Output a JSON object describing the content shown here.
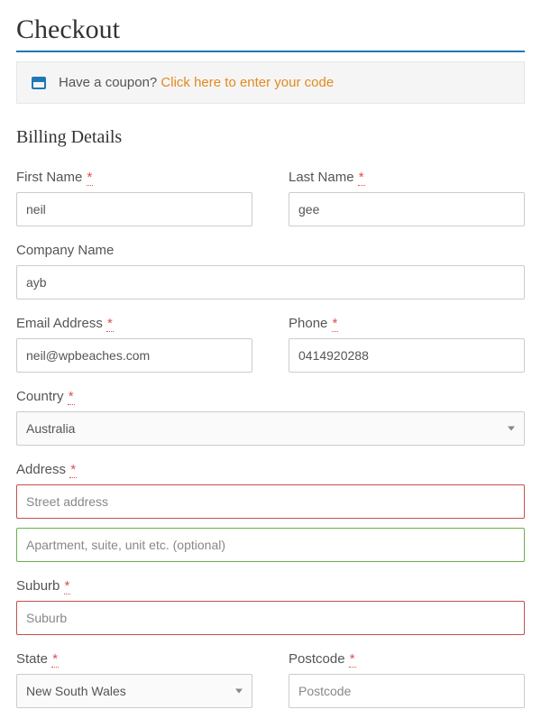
{
  "page_title": "Checkout",
  "coupon": {
    "prompt": "Have a coupon? ",
    "link_text": "Click here to enter your code"
  },
  "billing": {
    "section_title": "Billing Details",
    "first_name": {
      "label": "First Name",
      "value": "neil"
    },
    "last_name": {
      "label": "Last Name",
      "value": "gee"
    },
    "company": {
      "label": "Company Name",
      "value": "ayb"
    },
    "email": {
      "label": "Email Address",
      "value": "neil@wpbeaches.com"
    },
    "phone": {
      "label": "Phone",
      "value": "0414920288"
    },
    "country": {
      "label": "Country",
      "value": "Australia"
    },
    "address": {
      "label": "Address",
      "street_placeholder": "Street address",
      "apt_placeholder": "Apartment, suite, unit etc. (optional)"
    },
    "suburb": {
      "label": "Suburb",
      "placeholder": "Suburb"
    },
    "state": {
      "label": "State",
      "value": "New South Wales"
    },
    "postcode": {
      "label": "Postcode",
      "placeholder": "Postcode"
    }
  },
  "required_marker": "*"
}
